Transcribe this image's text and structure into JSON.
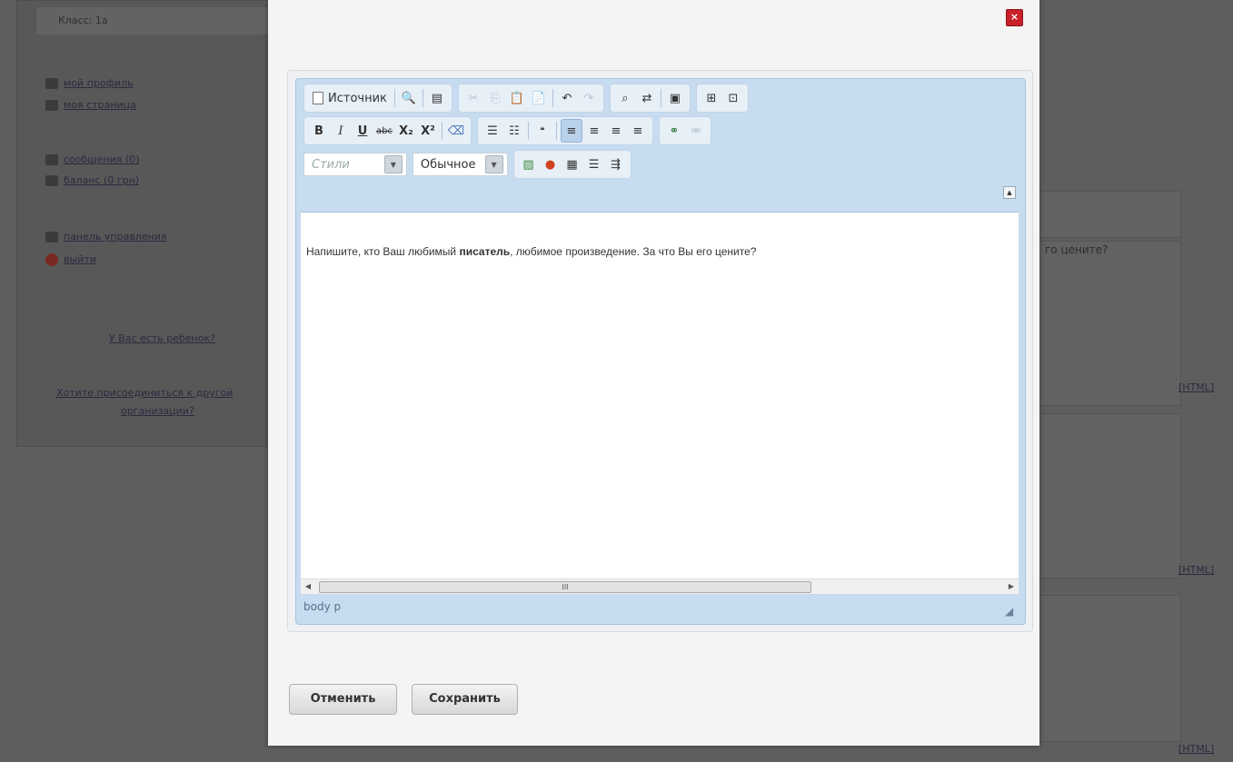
{
  "background": {
    "class_label": "Класс: 1а",
    "links": [
      "мой профиль",
      "моя страница",
      "сообщения (0)",
      "баланс (0 грн)",
      "панель управления",
      "выйти"
    ],
    "child_question": "У Вас есть ребенок?",
    "join_line1": "Хотите присоединиться к другой",
    "join_line2": "организации?",
    "right_text": "го цените?",
    "html_label": "[HTML]"
  },
  "modal": {
    "close_icon": "×",
    "toolbar": {
      "source_label": "Источник",
      "bold": "B",
      "italic": "I",
      "underline": "U",
      "strike": "abc",
      "subscript": "X₂",
      "superscript": "X²",
      "styles_placeholder": "Стили",
      "format_value": "Обычное"
    },
    "content": {
      "before": "Напишите, кто Ваш любимый ",
      "bold": "писатель",
      "after": ", любимое произведение. За что Вы его цените?"
    },
    "scroll_thumb": "III",
    "path": "body  p",
    "cancel_label": "Отменить",
    "save_label": "Сохранить"
  },
  "colors": {
    "overlay": "#5e5e5e",
    "editor_chrome": "#c7dcef",
    "close_red": "#c9202a"
  }
}
